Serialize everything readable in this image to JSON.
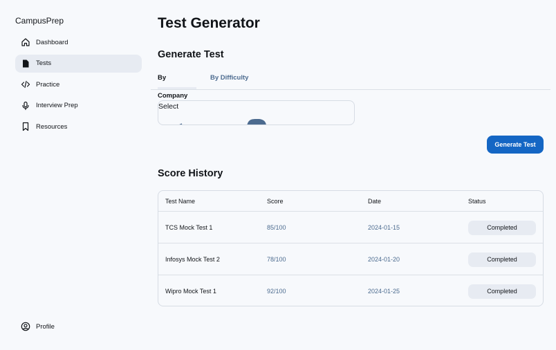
{
  "app": {
    "brand": "CampusPrep"
  },
  "sidebar": {
    "items": [
      {
        "label": "Dashboard",
        "icon": "home-icon",
        "active": false
      },
      {
        "label": "Tests",
        "icon": "file-icon",
        "active": true
      },
      {
        "label": "Practice",
        "icon": "code-icon",
        "active": false
      },
      {
        "label": "Interview Prep",
        "icon": "microphone-icon",
        "active": false
      },
      {
        "label": "Resources",
        "icon": "bookmark-icon",
        "active": false
      }
    ],
    "profile": {
      "label": "Profile",
      "icon": "user-circle-icon"
    }
  },
  "main": {
    "title": "Test Generator",
    "generate": {
      "title": "Generate Test",
      "tabs": [
        {
          "label": "By Company",
          "active": true
        },
        {
          "label": "By Difficulty",
          "active": false
        }
      ],
      "select": {
        "value": "Select"
      },
      "button_label": "Generate Test"
    },
    "history": {
      "title": "Score History",
      "columns": [
        "Test Name",
        "Score",
        "Date",
        "Status"
      ],
      "rows": [
        {
          "name": "TCS Mock Test 1",
          "score": "85/100",
          "date": "2024-01-15",
          "status": "Completed"
        },
        {
          "name": "Infosys Mock Test 2",
          "score": "78/100",
          "date": "2024-01-20",
          "status": "Completed"
        },
        {
          "name": "Wipro Mock Test 1",
          "score": "92/100",
          "date": "2024-01-25",
          "status": "Completed"
        }
      ]
    }
  },
  "colors": {
    "background": "#f7f9fc",
    "accent": "#1466c4",
    "muted_text": "#4c6b8f",
    "active_bg": "#e7ebf2",
    "arrow": "#4c6b8f"
  }
}
